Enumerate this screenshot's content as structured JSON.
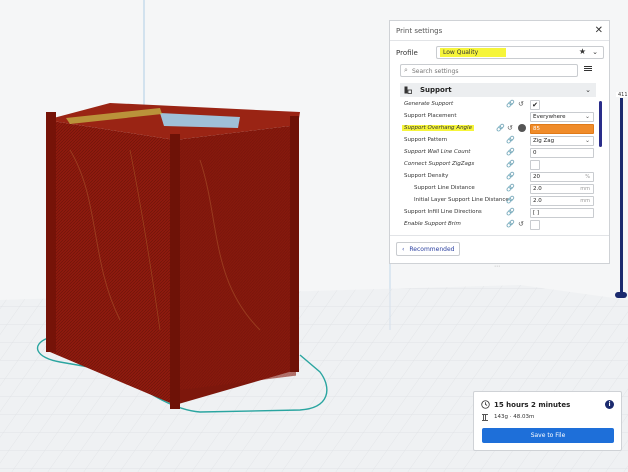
{
  "panel": {
    "title": "Print settings",
    "close": "✕",
    "profile_label": "Profile",
    "profile_value": "Low Quality",
    "search_placeholder": "Search settings",
    "category": "Support",
    "recommended_label": "Recommended"
  },
  "settings": [
    {
      "name": "Generate Support",
      "value": "✔",
      "kind": "check"
    },
    {
      "name": "Support Placement",
      "value": "Everywhere",
      "kind": "dropdown"
    },
    {
      "name": "Support Overhang Angle",
      "value": "85",
      "kind": "number",
      "highlighted": true
    },
    {
      "name": "Support Pattern",
      "value": "Zig Zag",
      "kind": "dropdown"
    },
    {
      "name": "Support Wall Line Count",
      "value": "0",
      "kind": "number"
    },
    {
      "name": "Connect Support ZigZags",
      "value": "",
      "kind": "check"
    },
    {
      "name": "Support Density",
      "value": "20",
      "unit": "%",
      "kind": "number"
    },
    {
      "name": "Support Line Distance",
      "value": "2.0",
      "unit": "mm",
      "kind": "number",
      "indent": true
    },
    {
      "name": "Initial Layer Support Line Distance",
      "value": "2.0",
      "unit": "mm",
      "kind": "number",
      "indent": true
    },
    {
      "name": "Support Infill Line Directions",
      "value": "[ ]",
      "kind": "text"
    },
    {
      "name": "Enable Support Brim",
      "value": "",
      "kind": "check"
    }
  ],
  "layer": {
    "top_label": "411"
  },
  "estimate": {
    "time": "15 hours 2 minutes",
    "material": "143g · 48.03m",
    "save_label": "Save to File"
  },
  "colors": {
    "model": "#8e1a0e",
    "accent": "#1e6fd9",
    "highlight": "#f6f53a",
    "warning": "#f08c2a",
    "outline": "#2aa5a0"
  }
}
